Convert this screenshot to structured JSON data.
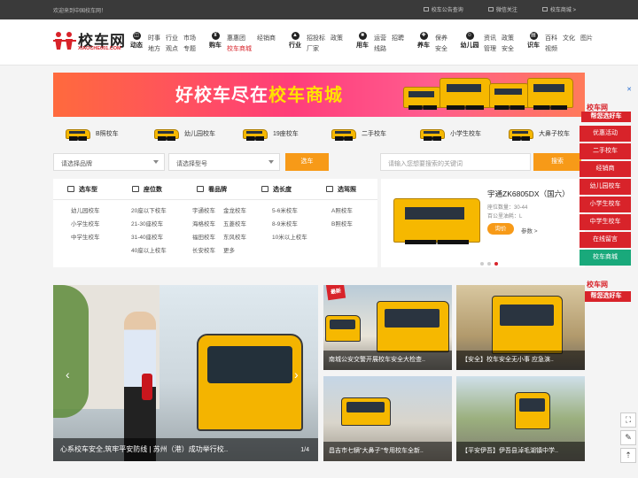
{
  "topbar": {
    "welcome": "欢迎来到中国校车网！",
    "links": [
      "校车公告查询",
      "微信关注",
      "校车商城 >"
    ]
  },
  "logo": {
    "name": "校车网",
    "url": "XIAOCHE001.COM"
  },
  "nav": [
    {
      "head": "动态",
      "icon": "news-icon",
      "items": [
        "时事",
        "行业",
        "市场",
        "地方",
        "观点",
        "专题"
      ]
    },
    {
      "head": "购车",
      "icon": "cart-icon",
      "items": [
        "惠惠团",
        "经销商",
        "校车商城"
      ],
      "highlight": "校车商城"
    },
    {
      "head": "行业",
      "icon": "industry-icon",
      "items": [
        "招投标",
        "政策",
        "厂家"
      ]
    },
    {
      "head": "用车",
      "icon": "car-icon",
      "items": [
        "运营",
        "招聘",
        "线路"
      ]
    },
    {
      "head": "养车",
      "icon": "wrench-icon",
      "items": [
        "保养",
        "安全"
      ]
    },
    {
      "head": "幼儿园",
      "icon": "kindergarten-icon",
      "items": [
        "资讯",
        "政策",
        "管理",
        "安全"
      ]
    },
    {
      "head": "识车",
      "icon": "book-icon",
      "items": [
        "百科",
        "文化",
        "图片",
        "视频"
      ]
    }
  ],
  "banner": {
    "text_a": "好校车尽在",
    "text_b": "校车商城"
  },
  "categories": [
    "B照校车",
    "幼儿园校车",
    "19座校车",
    "二手校车",
    "小学生校车",
    "大鼻子校车"
  ],
  "search": {
    "brand_placeholder": "请选择品牌",
    "model_placeholder": "请选择型号",
    "car_button": "选车",
    "keyword_placeholder": "请输入您想要搜索的关键词",
    "search_button": "搜索"
  },
  "filter": {
    "heads": [
      "选车型",
      "座位数",
      "看品牌",
      "选长度",
      "选驾照"
    ],
    "cols": [
      [
        "幼儿园校车",
        "小学生校车",
        "中学生校车"
      ],
      [
        "20座以下校车",
        "21-30座校车",
        "31-40座校车",
        "40座以上校车"
      ],
      [
        "宇通校车",
        "海格校车",
        "福田校车",
        "长安校车"
      ],
      [
        "金龙校车",
        "五菱校车",
        "东风校车",
        "更多"
      ],
      [
        "5-6米校车",
        "8-9米校车",
        "10米以上校车"
      ],
      [
        "A照校车",
        "B照校车"
      ]
    ]
  },
  "product": {
    "title": "宇通ZK6805DX（国六）",
    "seats": "座位数量：30-44",
    "fuel": "百公里油耗：L",
    "ask": "询价",
    "params": "参数 >"
  },
  "sidebar": {
    "card_line1": "校车网",
    "card_line2": "帮您选好车",
    "items": [
      "优惠活动",
      "二手校车",
      "经销商",
      "幼儿园校车",
      "小学生校车",
      "中学生校车",
      "在线留言",
      "校车商城"
    ]
  },
  "hero": {
    "caption": "心系校车安全,筑牢平安防线 | 苏州（港）成功举行校..",
    "page": "1/4"
  },
  "news": [
    {
      "caption": "南城公安交警开展校车安全大检查..",
      "badge": "最新"
    },
    {
      "caption": "【安全】校车安全无小事 应急演..",
      "badge": ""
    },
    {
      "caption": "昌吉市七辆\"大鼻子\"专用校车全新..",
      "badge": ""
    },
    {
      "caption": "【平安伊吾】伊吾县淖毛湖镇中学..",
      "badge": ""
    }
  ],
  "colors": {
    "accent": "#d8232a",
    "orange": "#f79a18",
    "green": "#19a97b"
  }
}
